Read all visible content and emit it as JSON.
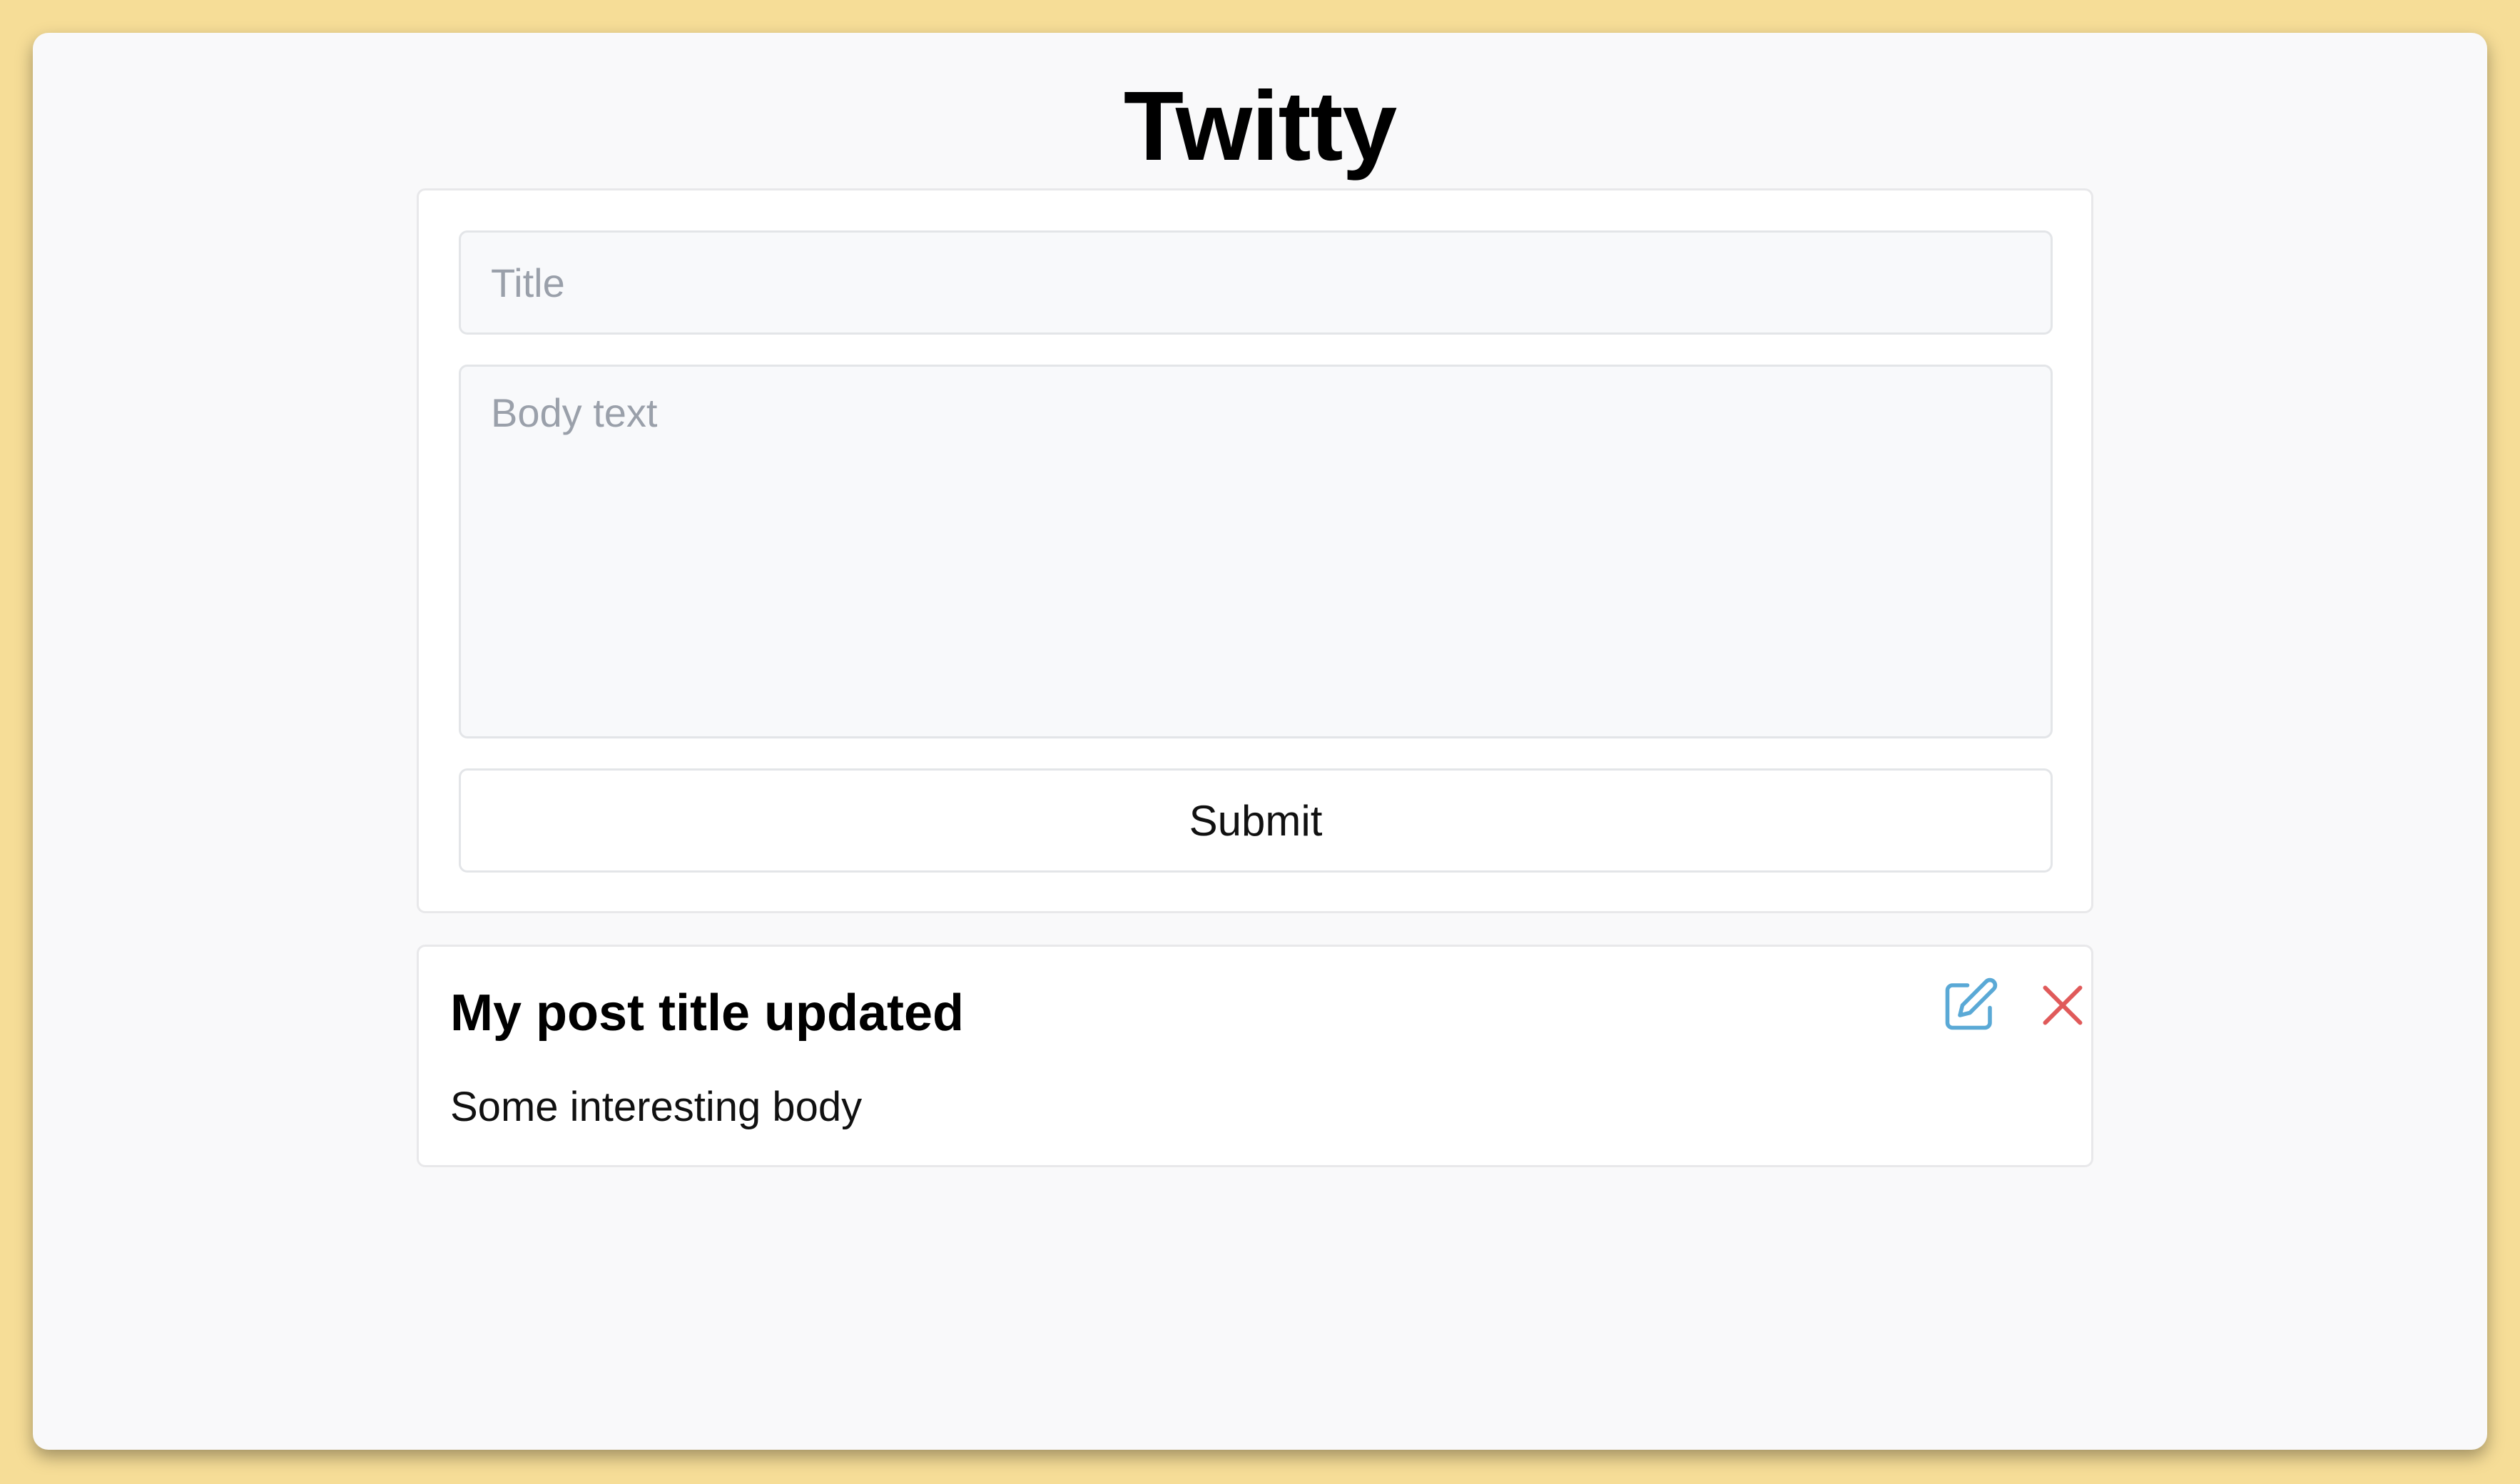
{
  "app": {
    "title": "Twitty"
  },
  "form": {
    "title_placeholder": "Title",
    "title_value": "",
    "body_placeholder": "Body text",
    "body_value": "",
    "submit_label": "Submit"
  },
  "posts": [
    {
      "title": "My post title updated",
      "body": "Some interesting body",
      "edit_icon": "edit-icon",
      "delete_icon": "close-icon"
    }
  ],
  "colors": {
    "background": "#f6dd97",
    "window": "#f9f9fa",
    "edit_icon": "#5aa9d6",
    "delete_icon": "#e05a5a"
  }
}
